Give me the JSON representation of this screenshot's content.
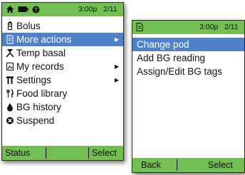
{
  "left_screen": {
    "status": {
      "time": "3:00p",
      "date": "2/11"
    },
    "menu": [
      {
        "label": "Bolus",
        "icon": "bolus-icon",
        "arrow": false,
        "selected": false
      },
      {
        "label": "More actions",
        "icon": "document-icon",
        "arrow": true,
        "selected": true
      },
      {
        "label": "Temp basal",
        "icon": "temp-basal-icon",
        "arrow": false,
        "selected": false
      },
      {
        "label": "My records",
        "icon": "records-icon",
        "arrow": true,
        "selected": false
      },
      {
        "label": "Settings",
        "icon": "settings-icon",
        "arrow": true,
        "selected": false
      },
      {
        "label": "Food library",
        "icon": "fork-knife-icon",
        "arrow": false,
        "selected": false
      },
      {
        "label": "BG history",
        "icon": "drop-icon",
        "arrow": false,
        "selected": false
      },
      {
        "label": "Suspend",
        "icon": "suspend-icon",
        "arrow": false,
        "selected": false
      }
    ],
    "softkeys": {
      "left": "Status",
      "right": "Select"
    }
  },
  "right_screen": {
    "status": {
      "time": "3:00p",
      "date": "2/11"
    },
    "menu": [
      {
        "label": "Change pod",
        "selected": true
      },
      {
        "label": "Add BG reading",
        "selected": false
      },
      {
        "label": "Assign/Edit BG tags",
        "selected": false
      }
    ],
    "softkeys": {
      "left": "Back",
      "right": "Select"
    }
  },
  "colors": {
    "bar": "#73bf53",
    "highlight": "#4f80c8"
  }
}
